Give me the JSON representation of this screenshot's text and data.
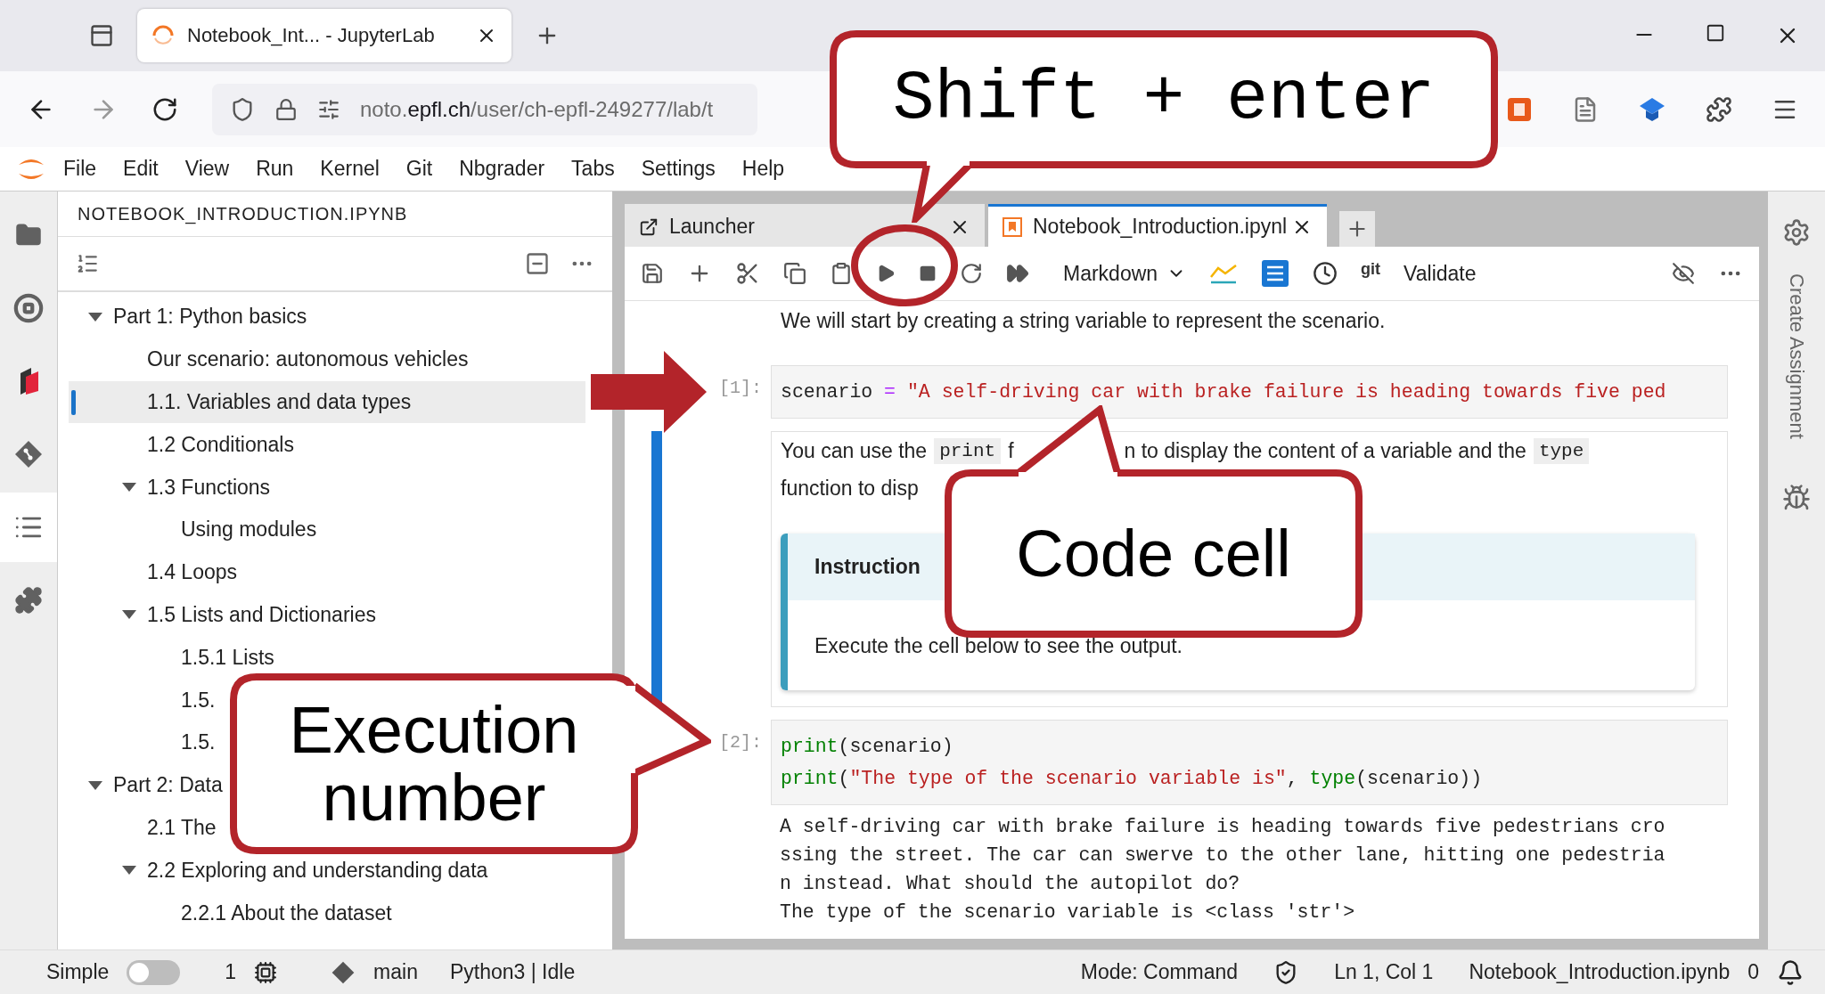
{
  "browser": {
    "tabs": [
      {
        "title": "Notebook_Int... - JupyterLab",
        "selected": true
      }
    ],
    "url": {
      "prefix": "noto.",
      "domain": "epfl.ch",
      "path": "/user/ch-epfl-249277/lab/t"
    }
  },
  "menu": [
    "File",
    "Edit",
    "View",
    "Run",
    "Kernel",
    "Git",
    "Nbgrader",
    "Tabs",
    "Settings",
    "Help"
  ],
  "activity_bar": [
    {
      "kind": "folder",
      "selected": false
    },
    {
      "kind": "running",
      "selected": false
    },
    {
      "kind": "grader",
      "selected": false
    },
    {
      "kind": "git",
      "selected": false
    },
    {
      "kind": "toc",
      "selected": true
    },
    {
      "kind": "extensions",
      "selected": false
    }
  ],
  "left_panel": {
    "title": "NOTEBOOK_INTRODUCTION.IPYNB",
    "toc": [
      {
        "label": "Part 1: Python basics",
        "selected": false,
        "expanded": true,
        "children": [
          {
            "label": "Our scenario: autonomous vehicles",
            "selected": false
          },
          {
            "label": "1.1. Variables and data types",
            "selected": true
          },
          {
            "label": "1.2 Conditionals",
            "selected": false
          },
          {
            "label": "1.3 Functions",
            "selected": false,
            "expanded": true,
            "children": [
              {
                "label": "Using modules",
                "selected": false
              }
            ]
          },
          {
            "label": "1.4 Loops",
            "selected": false
          },
          {
            "label": "1.5 Lists and Dictionaries",
            "selected": false,
            "expanded": true,
            "children": [
              {
                "label": "1.5.1 Lists",
                "selected": false
              },
              {
                "label": "1.5.",
                "selected": false
              },
              {
                "label": "1.5.",
                "selected": false
              }
            ]
          }
        ]
      },
      {
        "label": "Part 2: Data",
        "selected": false,
        "expanded": true,
        "children": [
          {
            "label": "2.1 The",
            "selected": false
          },
          {
            "label": "2.2 Exploring and understanding data",
            "selected": false,
            "expanded": true,
            "children": [
              {
                "label": "2.2.1 About the dataset",
                "selected": false
              }
            ]
          }
        ]
      }
    ]
  },
  "notebook": {
    "tabs": [
      {
        "label": "Launcher",
        "kind": "launcher",
        "selected": false
      },
      {
        "label": "Notebook_Introduction.ipynl",
        "kind": "notebook",
        "selected": true
      }
    ],
    "toolbar": {
      "cell_type": "Markdown",
      "git_label": "git",
      "validate": "Validate"
    },
    "cells": [
      {
        "kind": "markdown",
        "active": false,
        "lines": [
          [
            {
              "kind": "text",
              "text": "We will start by creating a string variable to represent the scenario."
            }
          ]
        ]
      },
      {
        "kind": "code",
        "active": false,
        "prompt": "[1]:",
        "lines": [
          [
            {
              "kind": "name",
              "text": "scenario"
            },
            {
              "kind": "op",
              "text": " = "
            },
            {
              "kind": "string",
              "text": "\"A self-driving car with brake failure is heading towards five ped"
            }
          ]
        ]
      },
      {
        "kind": "markdown",
        "active": true,
        "lines": [
          [
            {
              "kind": "text",
              "text": "You can use the"
            },
            {
              "kind": "code",
              "text": "print"
            },
            {
              "kind": "text",
              "text": "f"
            },
            {
              "kind": "gap_text",
              "text": "n to display the content of a variable and the"
            },
            {
              "kind": "code",
              "text": "type"
            }
          ],
          [
            {
              "kind": "text",
              "text": "function to disp"
            }
          ]
        ],
        "note": {
          "title": "Instruction",
          "body": "Execute the cell below to see the output."
        }
      },
      {
        "kind": "code",
        "active": false,
        "prompt": "[2]:",
        "lines": [
          [
            {
              "kind": "builtin",
              "text": "print"
            },
            {
              "kind": "name",
              "text": "(scenario)"
            }
          ],
          [
            {
              "kind": "builtin",
              "text": "print"
            },
            {
              "kind": "name",
              "text": "("
            },
            {
              "kind": "string",
              "text": "\"The type of the scenario variable is\""
            },
            {
              "kind": "name",
              "text": ", "
            },
            {
              "kind": "builtin",
              "text": "type"
            },
            {
              "kind": "name",
              "text": "(scenario))"
            }
          ]
        ],
        "output": [
          "A self-driving car with brake failure is heading towards five pedestrians cro",
          "ssing the street. The car can swerve to the other lane, hitting one pedestria",
          "n instead. What should the autopilot do?",
          "The type of the scenario variable is <class 'str'>"
        ]
      }
    ]
  },
  "right_panel": {
    "label": "Create Assignment"
  },
  "status_bar": {
    "mode_label": "Simple",
    "simple_on": false,
    "terminals": "1",
    "branch": "main",
    "kernel": "Python3 | Idle",
    "mode": "Mode: Command",
    "position": "Ln 1, Col 1",
    "file": "Notebook_Introduction.ipynb",
    "notifications": "0"
  },
  "annotations": [
    {
      "kind": "mono",
      "text": "Shift + enter"
    },
    {
      "kind": "sans",
      "text": "Code cell"
    },
    {
      "kind": "sans",
      "text": "Execution\nnumber"
    }
  ]
}
